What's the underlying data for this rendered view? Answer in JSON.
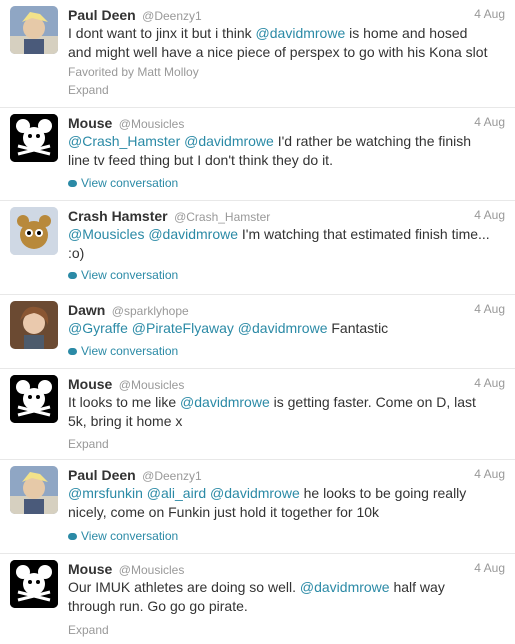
{
  "colors": {
    "link": "#2b8aa6",
    "muted": "#999999",
    "text": "#333333"
  },
  "tweets": [
    {
      "name": "Paul Deen",
      "handle": "@Deenzy1",
      "time": "4 Aug",
      "avatar": "paul-avatar",
      "line1_a": "I dont want to jinx it but i think ",
      "m1": "@davidmrowe",
      "line1_b": " is home and hosed",
      "line2": "and might well have a nice piece of perspex to go with his Kona slot",
      "favorited": "Favorited by Matt Molloy",
      "action": "Expand"
    },
    {
      "name": "Mouse",
      "handle": "@Mousicles",
      "time": "4 Aug",
      "m1": "@Crash_Hamster",
      "m2": "@davidmrowe",
      "line1_b": " I'd rather be watching the finish",
      "line2": "line tv feed thing but I don't think they do it.",
      "action": "View conversation"
    },
    {
      "name": "Crash Hamster",
      "handle": "@Crash_Hamster",
      "time": "4 Aug",
      "m1": "@Mousicles",
      "m2": "@davidmrowe",
      "line1_b": " I'm watching that estimated finish time...",
      "line2": ":o)",
      "action": "View conversation"
    },
    {
      "name": "Dawn",
      "handle": "@sparklyhope",
      "time": "4 Aug",
      "m1": "@Gyraffe",
      "m2": "@PirateFlyaway",
      "m3": "@davidmrowe",
      "line1_b": " Fantastic",
      "action": "View conversation"
    },
    {
      "name": "Mouse",
      "handle": "@Mousicles",
      "time": "4 Aug",
      "line1_a": "It looks to me like ",
      "m1": "@davidmrowe",
      "line1_b": " is getting faster.  Come on D, last",
      "line2": "5k, bring it home x",
      "action": "Expand"
    },
    {
      "name": "Paul Deen",
      "handle": "@Deenzy1",
      "time": "4 Aug",
      "m1": "@mrsfunkin",
      "m2": "@ali_aird",
      "m3": "@davidmrowe",
      "line1_b": " he looks to be going really",
      "line2": "nicely, come on Funkin just hold it together for 10k",
      "action": "View conversation"
    },
    {
      "name": "Mouse",
      "handle": "@Mousicles",
      "time": "4 Aug",
      "line1_a": "Our IMUK athletes are doing so well.  ",
      "m1": "@davidmrowe",
      "line1_b": " half way",
      "line2": "through run.  Go go go pirate.",
      "action": "Expand"
    }
  ]
}
